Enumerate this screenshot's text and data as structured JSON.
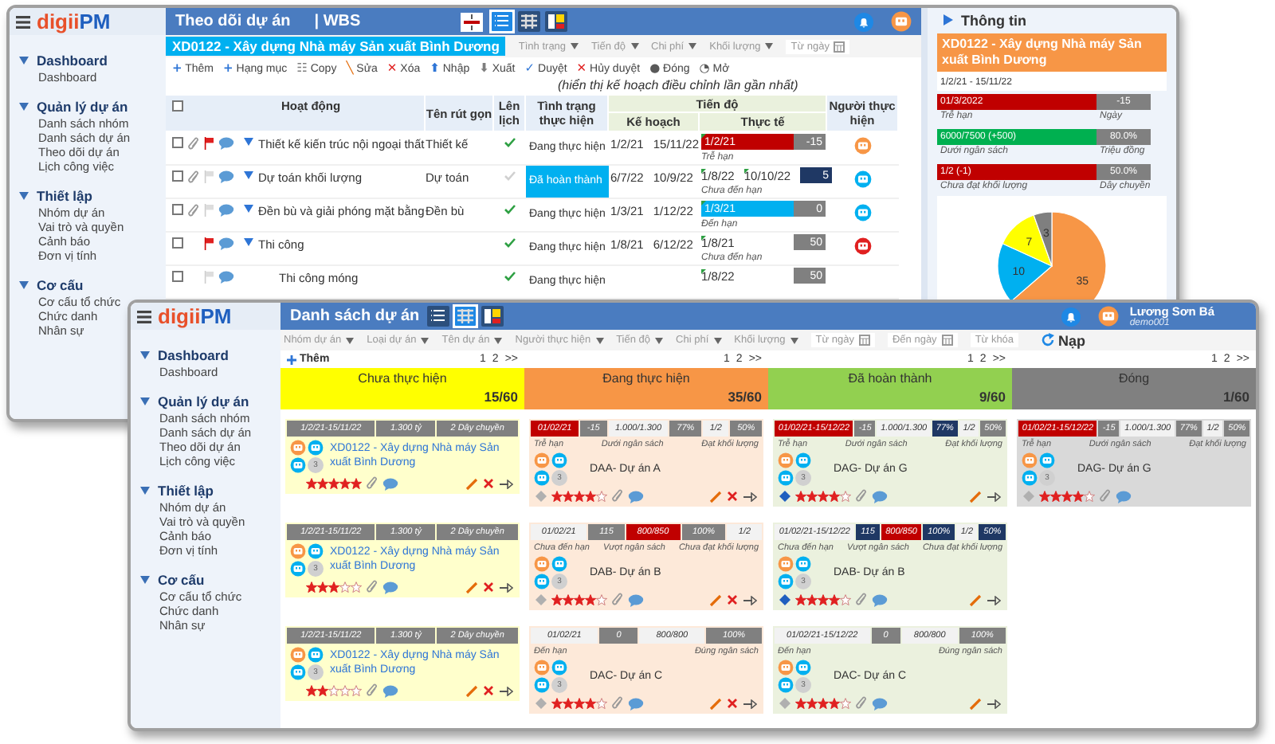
{
  "tracking_window": {
    "logo": {
      "prefix": "digii",
      "suffix": "PM"
    },
    "sidebar": {
      "groups": [
        {
          "title": "Dashboard",
          "expanded": true,
          "items": [
            "Dashboard"
          ]
        },
        {
          "title": "Quản lý dự án",
          "expanded": true,
          "items": [
            "Danh sách nhóm",
            "Danh sách dự án",
            "Theo dõi dự án",
            "Lịch công việc"
          ]
        },
        {
          "title": "Thiết lập",
          "expanded": true,
          "items": [
            "Nhóm dự án",
            "Vai trò và quyền",
            "Cảnh báo",
            "Đơn vị tính"
          ]
        },
        {
          "title": "Cơ cấu",
          "expanded": true,
          "items": [
            "Cơ cấu tổ chức",
            "Chức danh",
            "Nhân sự"
          ]
        }
      ]
    },
    "title": "Theo dõi dự án",
    "subtitle": "| WBS",
    "views": [
      {
        "kind": "list",
        "selected": true
      },
      {
        "kind": "grid",
        "selected": false
      },
      {
        "kind": "board",
        "selected": false
      }
    ],
    "project": "XD0122 - Xây dựng Nhà máy Sản xuất Bình Dương",
    "filters": [
      {
        "label": "Tình trạng",
        "kind": "dropdown"
      },
      {
        "label": "Tiến độ",
        "kind": "dropdown"
      },
      {
        "label": "Chi phí",
        "kind": "dropdown"
      },
      {
        "label": "Khối lượng",
        "kind": "dropdown"
      },
      {
        "label": "Từ ngày",
        "kind": "date"
      }
    ],
    "toolbar": [
      {
        "icon": "+",
        "label": "Thêm",
        "color": "#2e75d6"
      },
      {
        "icon": "+",
        "label": "Hạng mục",
        "color": "#2e75d6"
      },
      {
        "icon": "☷",
        "label": "Copy",
        "color": "#7f7f7f"
      },
      {
        "icon": "╲",
        "label": "Sửa",
        "color": "#e46c0a"
      },
      {
        "icon": "✕",
        "label": "Xóa",
        "color": "#e02020"
      },
      {
        "icon": "⬆",
        "label": "Nhập",
        "color": "#2e75d6"
      },
      {
        "icon": "⬇",
        "label": "Xuất",
        "color": "#7f7f7f"
      },
      {
        "icon": "✓",
        "label": "Duyệt",
        "color": "#2e75d6"
      },
      {
        "icon": "✕",
        "label": "Hủy duyệt",
        "color": "#e02020"
      },
      {
        "icon": "●",
        "label": "Đóng",
        "color": "#595959"
      },
      {
        "icon": "◔",
        "label": "Mở",
        "color": "#595959"
      }
    ],
    "note": "(hiển thị kế hoạch điều chỉnh lần gần nhất)",
    "table": {
      "columns": [
        "Hoạt động",
        "Tên rút gọn",
        "Lên lịch",
        "Tình trạng thực hiện",
        "Tiến độ",
        "Người thực hiện"
      ],
      "subcolumns": [
        "Kế hoạch",
        "Thực tế"
      ],
      "all_checked": false,
      "rows": [
        {
          "checked": false,
          "activity": "Thiết kế kiến trúc nội ngoại thất",
          "expanded": true,
          "attachment": true,
          "flagged": true,
          "short": "Thiết kế",
          "scheduled": true,
          "status": "Đang thực hiện",
          "highlighted": false,
          "plan_start": "1/2/21",
          "plan_end": "15/11/22",
          "actual_start": "1/2/21",
          "bar": {
            "color": "#c00000"
          },
          "days": {
            "text": "-15",
            "color": "#808080"
          },
          "deadline": "Trễ hạn",
          "assignee": {
            "color": "#f79646"
          }
        },
        {
          "checked": false,
          "activity": "Dự toán khối lượng",
          "expanded": true,
          "attachment": true,
          "flagged": false,
          "short": "Dự toán",
          "scheduled": false,
          "status": "Đã hoàn thành",
          "highlighted": true,
          "plan_start": "6/7/22",
          "plan_end": "10/9/22",
          "actual_start": "1/8/22",
          "actual_end": "10/10/22",
          "days": {
            "text": "5",
            "color": "#1f3864"
          },
          "deadline": "Chưa đến hạn",
          "assignee": {
            "color": "#00b0f0"
          }
        },
        {
          "checked": false,
          "activity": "Đền bù và giải phóng mặt bằng",
          "expanded": true,
          "attachment": true,
          "flagged": false,
          "short": "Đền bù",
          "scheduled": true,
          "status": "Đang thực hiện",
          "highlighted": false,
          "plan_start": "1/3/21",
          "plan_end": "1/12/22",
          "actual_start": "1/3/21",
          "bar": {
            "color": "#00b0f0"
          },
          "days": {
            "text": "0",
            "color": "#808080"
          },
          "deadline": "Đến hạn",
          "assignee": {
            "color": "#00b0f0"
          }
        },
        {
          "checked": false,
          "activity": "Thi công",
          "expanded": true,
          "attachment": false,
          "flagged": true,
          "scheduled": true,
          "status": "Đang thực hiện",
          "highlighted": false,
          "plan_start": "1/8/21",
          "plan_end": "6/12/22",
          "actual_start": "1/8/21",
          "days": {
            "text": "50",
            "color": "#808080"
          },
          "deadline": "Chưa đến hạn",
          "assignee": {
            "color": "#e02020"
          },
          "children": [
            {
              "checked": false,
              "activity": "Thi công móng",
              "attachment": false,
              "flagged": false,
              "scheduled": true,
              "status": "Đang thực hiện",
              "highlighted": false,
              "actual_start": "1/8/22",
              "days": {
                "text": "50",
                "color": "#808080"
              }
            }
          ]
        }
      ]
    },
    "info": {
      "title": "Thông tin",
      "project": "XD0122 - Xây dựng Nhà máy Sản xuất Bình Dương",
      "period": "1/2/21 - 15/11/22",
      "metrics": [
        {
          "bar": {
            "text": "01/3/2022",
            "color": "#c00000"
          },
          "value": "-15",
          "label": "Trễ hạn",
          "unit": "Ngày"
        },
        {
          "bar": {
            "text": "6000/7500 (+500)",
            "color": "#00b050"
          },
          "value": "80.0%",
          "label": "Dưới ngân sách",
          "unit": "Triệu đồng"
        },
        {
          "bar": {
            "text": "1/2 (-1)",
            "color": "#c00000"
          },
          "value": "50.0%",
          "label": "Chưa đạt khối lượng",
          "unit": "Dây chuyền"
        }
      ],
      "chart_data": {
        "type": "pie",
        "data_labels": true,
        "values": [
          35,
          10,
          7,
          3
        ],
        "colors": [
          "#f79646",
          "#00b0f0",
          "#ffff00",
          "#7f7f7f"
        ]
      }
    }
  },
  "list_window": {
    "logo": {
      "prefix": "digii",
      "suffix": "PM"
    },
    "sidebar": {
      "groups": [
        {
          "title": "Dashboard",
          "expanded": true,
          "items": [
            "Dashboard"
          ]
        },
        {
          "title": "Quản lý dự án",
          "expanded": true,
          "items": [
            "Danh sách nhóm",
            "Danh sách dự án",
            "Theo dõi dự án",
            "Lịch công việc"
          ]
        },
        {
          "title": "Thiết lập",
          "expanded": true,
          "items": [
            "Nhóm dự án",
            "Vai trò và quyền",
            "Cảnh báo",
            "Đơn vị tính"
          ]
        },
        {
          "title": "Cơ cấu",
          "expanded": true,
          "items": [
            "Cơ cấu tổ chức",
            "Chức danh",
            "Nhân sự"
          ]
        }
      ]
    },
    "title": "Danh sách dự án",
    "views": [
      {
        "kind": "list",
        "selected": false
      },
      {
        "kind": "grid",
        "selected": true
      },
      {
        "kind": "board",
        "selected": false
      }
    ],
    "user": {
      "name": "Lương Sơn Bá",
      "account": "demo001"
    },
    "filters": [
      {
        "label": "Nhóm dự án",
        "kind": "dropdown"
      },
      {
        "label": "Loại dự án",
        "kind": "dropdown"
      },
      {
        "label": "Tên dự án",
        "kind": "dropdown"
      },
      {
        "label": "Người thực hiện",
        "kind": "dropdown"
      },
      {
        "label": "Tiến độ",
        "kind": "dropdown"
      },
      {
        "label": "Chi phí",
        "kind": "dropdown"
      },
      {
        "label": "Khối lượng",
        "kind": "dropdown"
      },
      {
        "label": "Từ ngày",
        "kind": "date"
      },
      {
        "label": "Đến ngày",
        "kind": "date"
      },
      {
        "label": "Từ khóa",
        "kind": "text"
      }
    ],
    "reload": "Nạp",
    "add": "Thêm",
    "columns": [
      {
        "title": "Chưa thực hiện",
        "count": "15/60",
        "color": "#ffff00",
        "pages": [
          "1",
          "2",
          ">>"
        ],
        "cards": [
          {
            "kind": "summary",
            "color": "#ffffcc",
            "stats": [
              {
                "text": "1/2/21-15/11/22",
                "color": "#808080"
              },
              {
                "text": "1.300 tỷ",
                "color": "#808080"
              },
              {
                "text": "2 Dây chuyền",
                "color": "#808080"
              }
            ],
            "title": "XD0122 - Xây dựng Nhà máy Sản xuất Bình Dương",
            "avatars": [
              {
                "color": "#f79646"
              },
              {
                "color": "#00b0f0"
              },
              {
                "color": "#00b0f0"
              }
            ],
            "more": "3",
            "stars": 5,
            "editable": true,
            "deletable": true,
            "openable": true
          },
          {
            "kind": "summary",
            "color": "#ffffcc",
            "stats": [
              {
                "text": "1/2/21-15/11/22",
                "color": "#808080"
              },
              {
                "text": "1.300 tỷ",
                "color": "#808080"
              },
              {
                "text": "2 Dây chuyền",
                "color": "#808080"
              }
            ],
            "title": "XD0122 - Xây dựng Nhà máy Sản xuất Bình Dương",
            "avatars": [
              {
                "color": "#f79646"
              },
              {
                "color": "#00b0f0"
              },
              {
                "color": "#00b0f0"
              }
            ],
            "more": "3",
            "stars": 3,
            "editable": true,
            "deletable": true,
            "openable": true
          },
          {
            "kind": "summary",
            "color": "#ffffcc",
            "stats": [
              {
                "text": "1/2/21-15/11/22",
                "color": "#808080"
              },
              {
                "text": "1.300 tỷ",
                "color": "#808080"
              },
              {
                "text": "2 Dây chuyền",
                "color": "#808080"
              }
            ],
            "title": "XD0122 - Xây dựng Nhà máy Sản xuất Bình Dương",
            "avatars": [
              {
                "color": "#f79646"
              },
              {
                "color": "#00b0f0"
              },
              {
                "color": "#00b0f0"
              }
            ],
            "more": "3",
            "stars": 2,
            "editable": true,
            "deletable": true,
            "openable": true
          }
        ]
      },
      {
        "title": "Đang thực hiện",
        "count": "35/60",
        "color": "#f79646",
        "pages": [
          "1",
          "2",
          ">>"
        ],
        "cards": [
          {
            "kind": "progress",
            "color": "#fde9d9",
            "stats": [
              {
                "text": "01/02/21",
                "color": "#c00000"
              },
              {
                "text": "-15",
                "color": "#808080"
              },
              {
                "text": "1.000/1.300",
                "color": "#f2f2f2"
              },
              {
                "text": "77%",
                "color": "#808080"
              },
              {
                "text": "1/2",
                "color": "#f2f2f2"
              },
              {
                "text": "50%",
                "color": "#808080"
              }
            ],
            "labels": [
              "Trễ hạn",
              "Dưới ngân sách",
              "Đạt khối lượng"
            ],
            "title": "DAA- Dự án A",
            "avatars": [
              {
                "color": "#f79646"
              },
              {
                "color": "#00b0f0"
              },
              {
                "color": "#00b0f0"
              }
            ],
            "more": "3",
            "pinned": false,
            "stars": 4,
            "editable": true,
            "deletable": true,
            "openable": true
          },
          {
            "kind": "progress",
            "color": "#fde9d9",
            "stats": [
              {
                "text": "01/02/21",
                "color": "#f2f2f2"
              },
              {
                "text": "115",
                "color": "#808080"
              },
              {
                "text": "800/850",
                "color": "#c00000"
              },
              {
                "text": "100%",
                "color": "#808080"
              },
              {
                "text": "1/2",
                "color": "#f2f2f2"
              }
            ],
            "labels": [
              "Chưa đến hạn",
              "Vượt ngân sách",
              "Chưa đạt khối lượng"
            ],
            "title": "DAB- Dự án B",
            "avatars": [
              {
                "color": "#f79646"
              },
              {
                "color": "#00b0f0"
              },
              {
                "color": "#00b0f0"
              }
            ],
            "more": "3",
            "pinned": false,
            "stars": 4,
            "editable": true,
            "deletable": true,
            "openable": true
          },
          {
            "kind": "progress",
            "color": "#fde9d9",
            "stats": [
              {
                "text": "01/02/21",
                "color": "#f2f2f2"
              },
              {
                "text": "0",
                "color": "#808080"
              },
              {
                "text": "800/800",
                "color": "#f2f2f2"
              },
              {
                "text": "100%",
                "color": "#808080"
              }
            ],
            "labels": [
              "Đến hạn",
              "Đúng ngân sách"
            ],
            "title": "DAC- Dự án C",
            "avatars": [
              {
                "color": "#f79646"
              },
              {
                "color": "#00b0f0"
              },
              {
                "color": "#00b0f0"
              }
            ],
            "more": "3",
            "pinned": false,
            "stars": 4,
            "editable": true,
            "deletable": true,
            "openable": true
          }
        ]
      },
      {
        "title": "Đã hoàn thành",
        "count": "9/60",
        "color": "#92d050",
        "pages": [
          "1",
          "2",
          ">>"
        ],
        "cards": [
          {
            "kind": "progress",
            "color": "#ebf1de",
            "stats": [
              {
                "text": "01/02/21-15/12/22",
                "color": "#c00000"
              },
              {
                "text": "-15",
                "color": "#808080"
              },
              {
                "text": "1.000/1.300",
                "color": "#f2f2f2"
              },
              {
                "text": "77%",
                "color": "#1f3864"
              },
              {
                "text": "1/2",
                "color": "#f2f2f2"
              },
              {
                "text": "50%",
                "color": "#808080"
              }
            ],
            "labels": [
              "Trễ hạn",
              "Dưới ngân sách",
              "Đạt khối lượng"
            ],
            "title": "DAG- Dự án G",
            "avatars": [
              {
                "color": "#f79646"
              },
              {
                "color": "#00b0f0"
              },
              {
                "color": "#00b0f0"
              }
            ],
            "more": "3",
            "pinned": true,
            "stars": 4,
            "editable": true,
            "deletable": false,
            "openable": true
          },
          {
            "kind": "progress",
            "color": "#ebf1de",
            "stats": [
              {
                "text": "01/02/21-15/12/22",
                "color": "#f2f2f2"
              },
              {
                "text": "115",
                "color": "#1f3864"
              },
              {
                "text": "800/850",
                "color": "#c00000"
              },
              {
                "text": "100%",
                "color": "#1f3864"
              },
              {
                "text": "1/2",
                "color": "#f2f2f2"
              },
              {
                "text": "50%",
                "color": "#1f3864"
              }
            ],
            "labels": [
              "Chưa đến hạn",
              "Vượt ngân sách",
              "Chưa đạt khối lượng"
            ],
            "title": "DAB- Dự án B",
            "avatars": [
              {
                "color": "#f79646"
              },
              {
                "color": "#00b0f0"
              },
              {
                "color": "#00b0f0"
              }
            ],
            "more": "3",
            "pinned": true,
            "stars": 4,
            "editable": true,
            "deletable": false,
            "openable": true
          },
          {
            "kind": "progress",
            "color": "#ebf1de",
            "stats": [
              {
                "text": "01/02/21-15/12/22",
                "color": "#f2f2f2"
              },
              {
                "text": "0",
                "color": "#808080"
              },
              {
                "text": "800/800",
                "color": "#f2f2f2"
              },
              {
                "text": "100%",
                "color": "#808080"
              }
            ],
            "labels": [
              "Đến hạn",
              "Đúng ngân sách"
            ],
            "title": "DAC- Dự án C",
            "avatars": [
              {
                "color": "#f79646"
              },
              {
                "color": "#00b0f0"
              },
              {
                "color": "#00b0f0"
              }
            ],
            "more": "3",
            "pinned": false,
            "stars": 4,
            "editable": true,
            "deletable": false,
            "openable": true
          }
        ]
      },
      {
        "title": "Đóng",
        "count": "1/60",
        "color": "#808080",
        "pages": [
          "1",
          "2",
          ">>"
        ],
        "cards": [
          {
            "kind": "progress",
            "color": "#d9d9d9",
            "stats": [
              {
                "text": "01/02/21-15/12/22",
                "color": "#c00000"
              },
              {
                "text": "-15",
                "color": "#808080"
              },
              {
                "text": "1.000/1.300",
                "color": "#f2f2f2"
              },
              {
                "text": "77%",
                "color": "#808080"
              },
              {
                "text": "1/2",
                "color": "#f2f2f2"
              },
              {
                "text": "50%",
                "color": "#808080"
              }
            ],
            "labels": [
              "Trễ hạn",
              "Dưới ngân sách",
              "Đạt khối lượng"
            ],
            "title": "DAG- Dự án G",
            "avatars": [
              {
                "color": "#f79646"
              },
              {
                "color": "#00b0f0"
              },
              {
                "color": "#00b0f0"
              }
            ],
            "more": "3",
            "pinned": false,
            "stars": 4,
            "editable": false,
            "deletable": false,
            "openable": false
          }
        ]
      }
    ]
  }
}
